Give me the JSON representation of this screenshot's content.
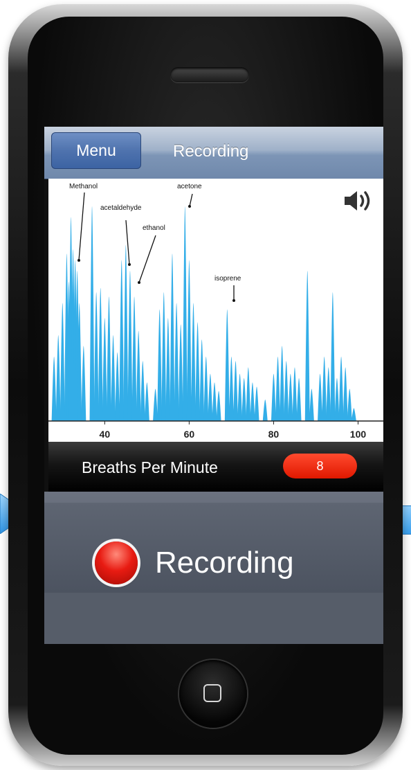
{
  "navbar": {
    "menu_label": "Menu",
    "title": "Recording"
  },
  "chart": {
    "annotations": [
      "Methanol",
      "acetaldehyde",
      "ethanol",
      "acetone",
      "isoprene"
    ],
    "x_ticks": [
      "40",
      "60",
      "80",
      "100"
    ],
    "bar_color": "#33aee8",
    "speaker_icon": "speaker-volume-icon"
  },
  "chart_data": {
    "type": "bar",
    "xlim": [
      27,
      105
    ],
    "ylim": [
      0,
      100
    ],
    "x_ticks": [
      40,
      60,
      80,
      100
    ],
    "annotations": [
      {
        "label": "Methanol",
        "x": 33
      },
      {
        "label": "acetaldehyde",
        "x": 44
      },
      {
        "label": "ethanol",
        "x": 46
      },
      {
        "label": "acetone",
        "x": 59
      },
      {
        "label": "isoprene",
        "x": 69
      }
    ],
    "peaks": [
      [
        28,
        30
      ],
      [
        29,
        40
      ],
      [
        30,
        55
      ],
      [
        31,
        78
      ],
      [
        31.5,
        65
      ],
      [
        32,
        95
      ],
      [
        32.5,
        80
      ],
      [
        33,
        75
      ],
      [
        33.5,
        70
      ],
      [
        34,
        55
      ],
      [
        35,
        35
      ],
      [
        37,
        100
      ],
      [
        38,
        60
      ],
      [
        39,
        62
      ],
      [
        40,
        48
      ],
      [
        41,
        58
      ],
      [
        42,
        40
      ],
      [
        43,
        32
      ],
      [
        44,
        75
      ],
      [
        45,
        82
      ],
      [
        46,
        70
      ],
      [
        47,
        58
      ],
      [
        48,
        42
      ],
      [
        49,
        28
      ],
      [
        50,
        18
      ],
      [
        52,
        15
      ],
      [
        53,
        52
      ],
      [
        54,
        60
      ],
      [
        55,
        48
      ],
      [
        56,
        78
      ],
      [
        57,
        55
      ],
      [
        58,
        45
      ],
      [
        59,
        100
      ],
      [
        60,
        75
      ],
      [
        61,
        55
      ],
      [
        62,
        46
      ],
      [
        63,
        38
      ],
      [
        64,
        30
      ],
      [
        65,
        22
      ],
      [
        66,
        18
      ],
      [
        67,
        14
      ],
      [
        69,
        52
      ],
      [
        70,
        30
      ],
      [
        71,
        28
      ],
      [
        72,
        22
      ],
      [
        73,
        20
      ],
      [
        74,
        25
      ],
      [
        75,
        18
      ],
      [
        76,
        16
      ],
      [
        78,
        10
      ],
      [
        80,
        22
      ],
      [
        81,
        30
      ],
      [
        82,
        35
      ],
      [
        83,
        28
      ],
      [
        84,
        22
      ],
      [
        85,
        25
      ],
      [
        86,
        20
      ],
      [
        88,
        70
      ],
      [
        89,
        15
      ],
      [
        91,
        22
      ],
      [
        92,
        30
      ],
      [
        93,
        25
      ],
      [
        94,
        60
      ],
      [
        95,
        20
      ],
      [
        96,
        30
      ],
      [
        97,
        25
      ],
      [
        98,
        15
      ],
      [
        99,
        6
      ]
    ]
  },
  "bpm": {
    "label": "Breaths Per Minute",
    "value": "8",
    "badge_color": "#ff3a1e"
  },
  "recording": {
    "label": "Recording",
    "status_color": "#e81b12"
  },
  "icons": {
    "home": "home-button-icon",
    "record": "record-dot-icon"
  }
}
